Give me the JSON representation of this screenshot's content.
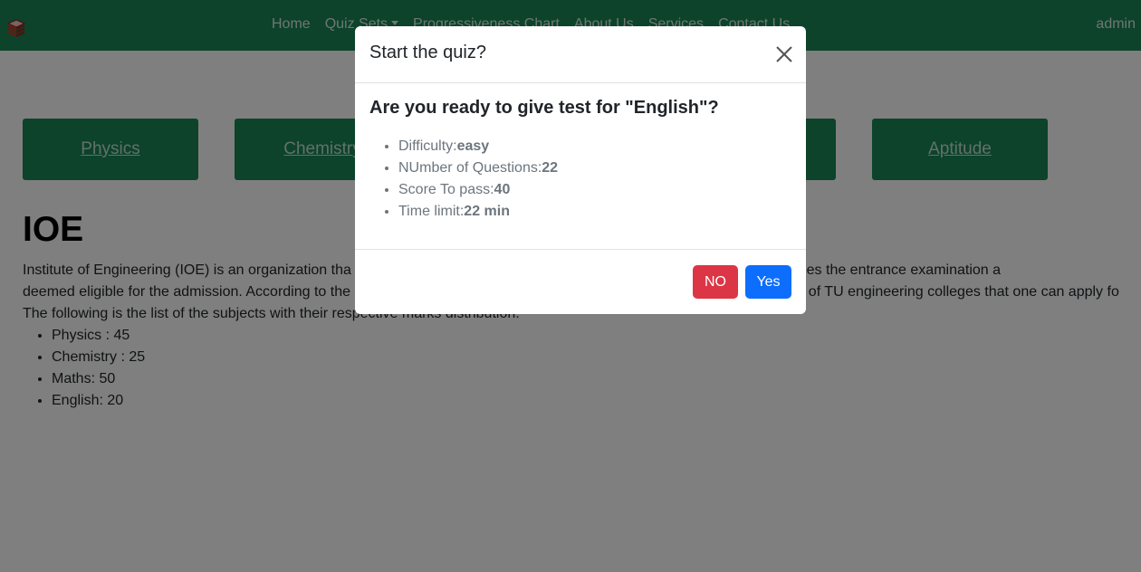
{
  "navbar": {
    "links": [
      "Home",
      "Quiz Sets",
      "Progressiveness Chart",
      "About Us",
      "Services",
      "Contact Us"
    ],
    "user": "admin",
    "logo_icon": "stacked-books-icon",
    "bg_color": "#198754"
  },
  "subjects": [
    "Physics",
    "Chemistry",
    "Aptitude"
  ],
  "page": {
    "title": "IOE",
    "paragraph_lines": [
      "Institute of Engineering (IOE) is an organization tha",
      "se candidate who passes the entrance examination a",
      "deemed eligible for the admission. According to the",
      "ion of TU engineering colleges that one can apply fo",
      "The following is the list of the subjects with their respective marks distribution."
    ],
    "marks": [
      "Physics : 45",
      "Chemistry : 25",
      "Maths: 50",
      "English: 20"
    ]
  },
  "modal": {
    "title": "Start the quiz?",
    "question_prefix": "Are you ready to give test for \"",
    "subject": "English",
    "question_suffix": "\"?",
    "details": [
      {
        "label": "Difficulty:",
        "value": "easy"
      },
      {
        "label": "NUmber of Questions:",
        "value": "22"
      },
      {
        "label": "Score To pass:",
        "value": "40"
      },
      {
        "label": "Time limit:",
        "value": "22 min"
      }
    ],
    "no_label": "NO",
    "yes_label": "Yes",
    "close_icon": "close-icon"
  },
  "colors": {
    "danger": "#dc3545",
    "primary": "#0d6efd",
    "success": "#198754"
  }
}
